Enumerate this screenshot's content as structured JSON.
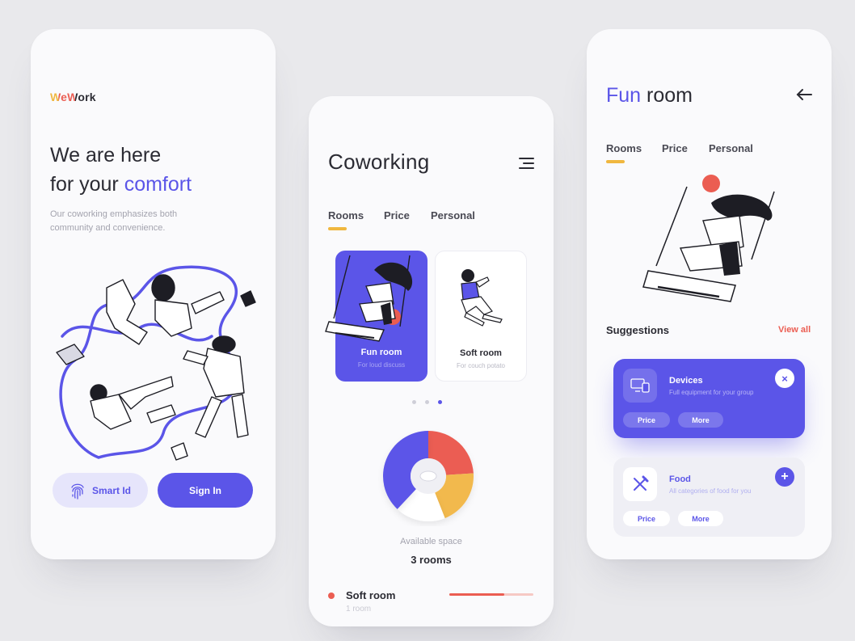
{
  "phone1": {
    "logo": {
      "part1": "We",
      "part2": "Work"
    },
    "headline": {
      "line1": "We are here",
      "line2_prefix": "for your ",
      "line2_accent": "comfort"
    },
    "subtext": "Our coworking emphasizes both community and convenience.",
    "smart_id_label": "Smart Id",
    "sign_in_label": "Sign In"
  },
  "phone2": {
    "title": "Coworking",
    "tabs": [
      "Rooms",
      "Price",
      "Personal"
    ],
    "cards": [
      {
        "label": "Fun room",
        "sub": "For loud discuss"
      },
      {
        "label": "Soft room",
        "sub": "For couch potato"
      }
    ],
    "pager": {
      "count": 3,
      "active": 3
    },
    "available_label": "Available space",
    "rooms_count": "3 rooms",
    "list": [
      {
        "title": "Soft room",
        "sub": "1 room",
        "progress": 0.65
      }
    ],
    "donut": [
      {
        "color": "#eb5d52",
        "value": 0.24
      },
      {
        "color": "#f2b94d",
        "value": 0.2
      },
      {
        "color": "#ffffff",
        "value": 0.18
      },
      {
        "color": "#5b55e8",
        "value": 0.38
      }
    ]
  },
  "phone3": {
    "title_accent": "Fun",
    "title_rest": " room",
    "tabs": [
      "Rooms",
      "Price",
      "Personal"
    ],
    "suggestions_label": "Suggestions",
    "view_all_label": "View all",
    "suggestions": [
      {
        "title": "Devices",
        "desc": "Full equipment for your group",
        "price_label": "Price",
        "more_label": "More"
      },
      {
        "title": "Food",
        "desc": "All categories of food for you",
        "price_label": "Price",
        "more_label": "More"
      }
    ]
  },
  "colors": {
    "accent": "#5b55e8",
    "yellow": "#f0b73f",
    "red": "#eb5d52",
    "background": "#e9e9ec"
  }
}
